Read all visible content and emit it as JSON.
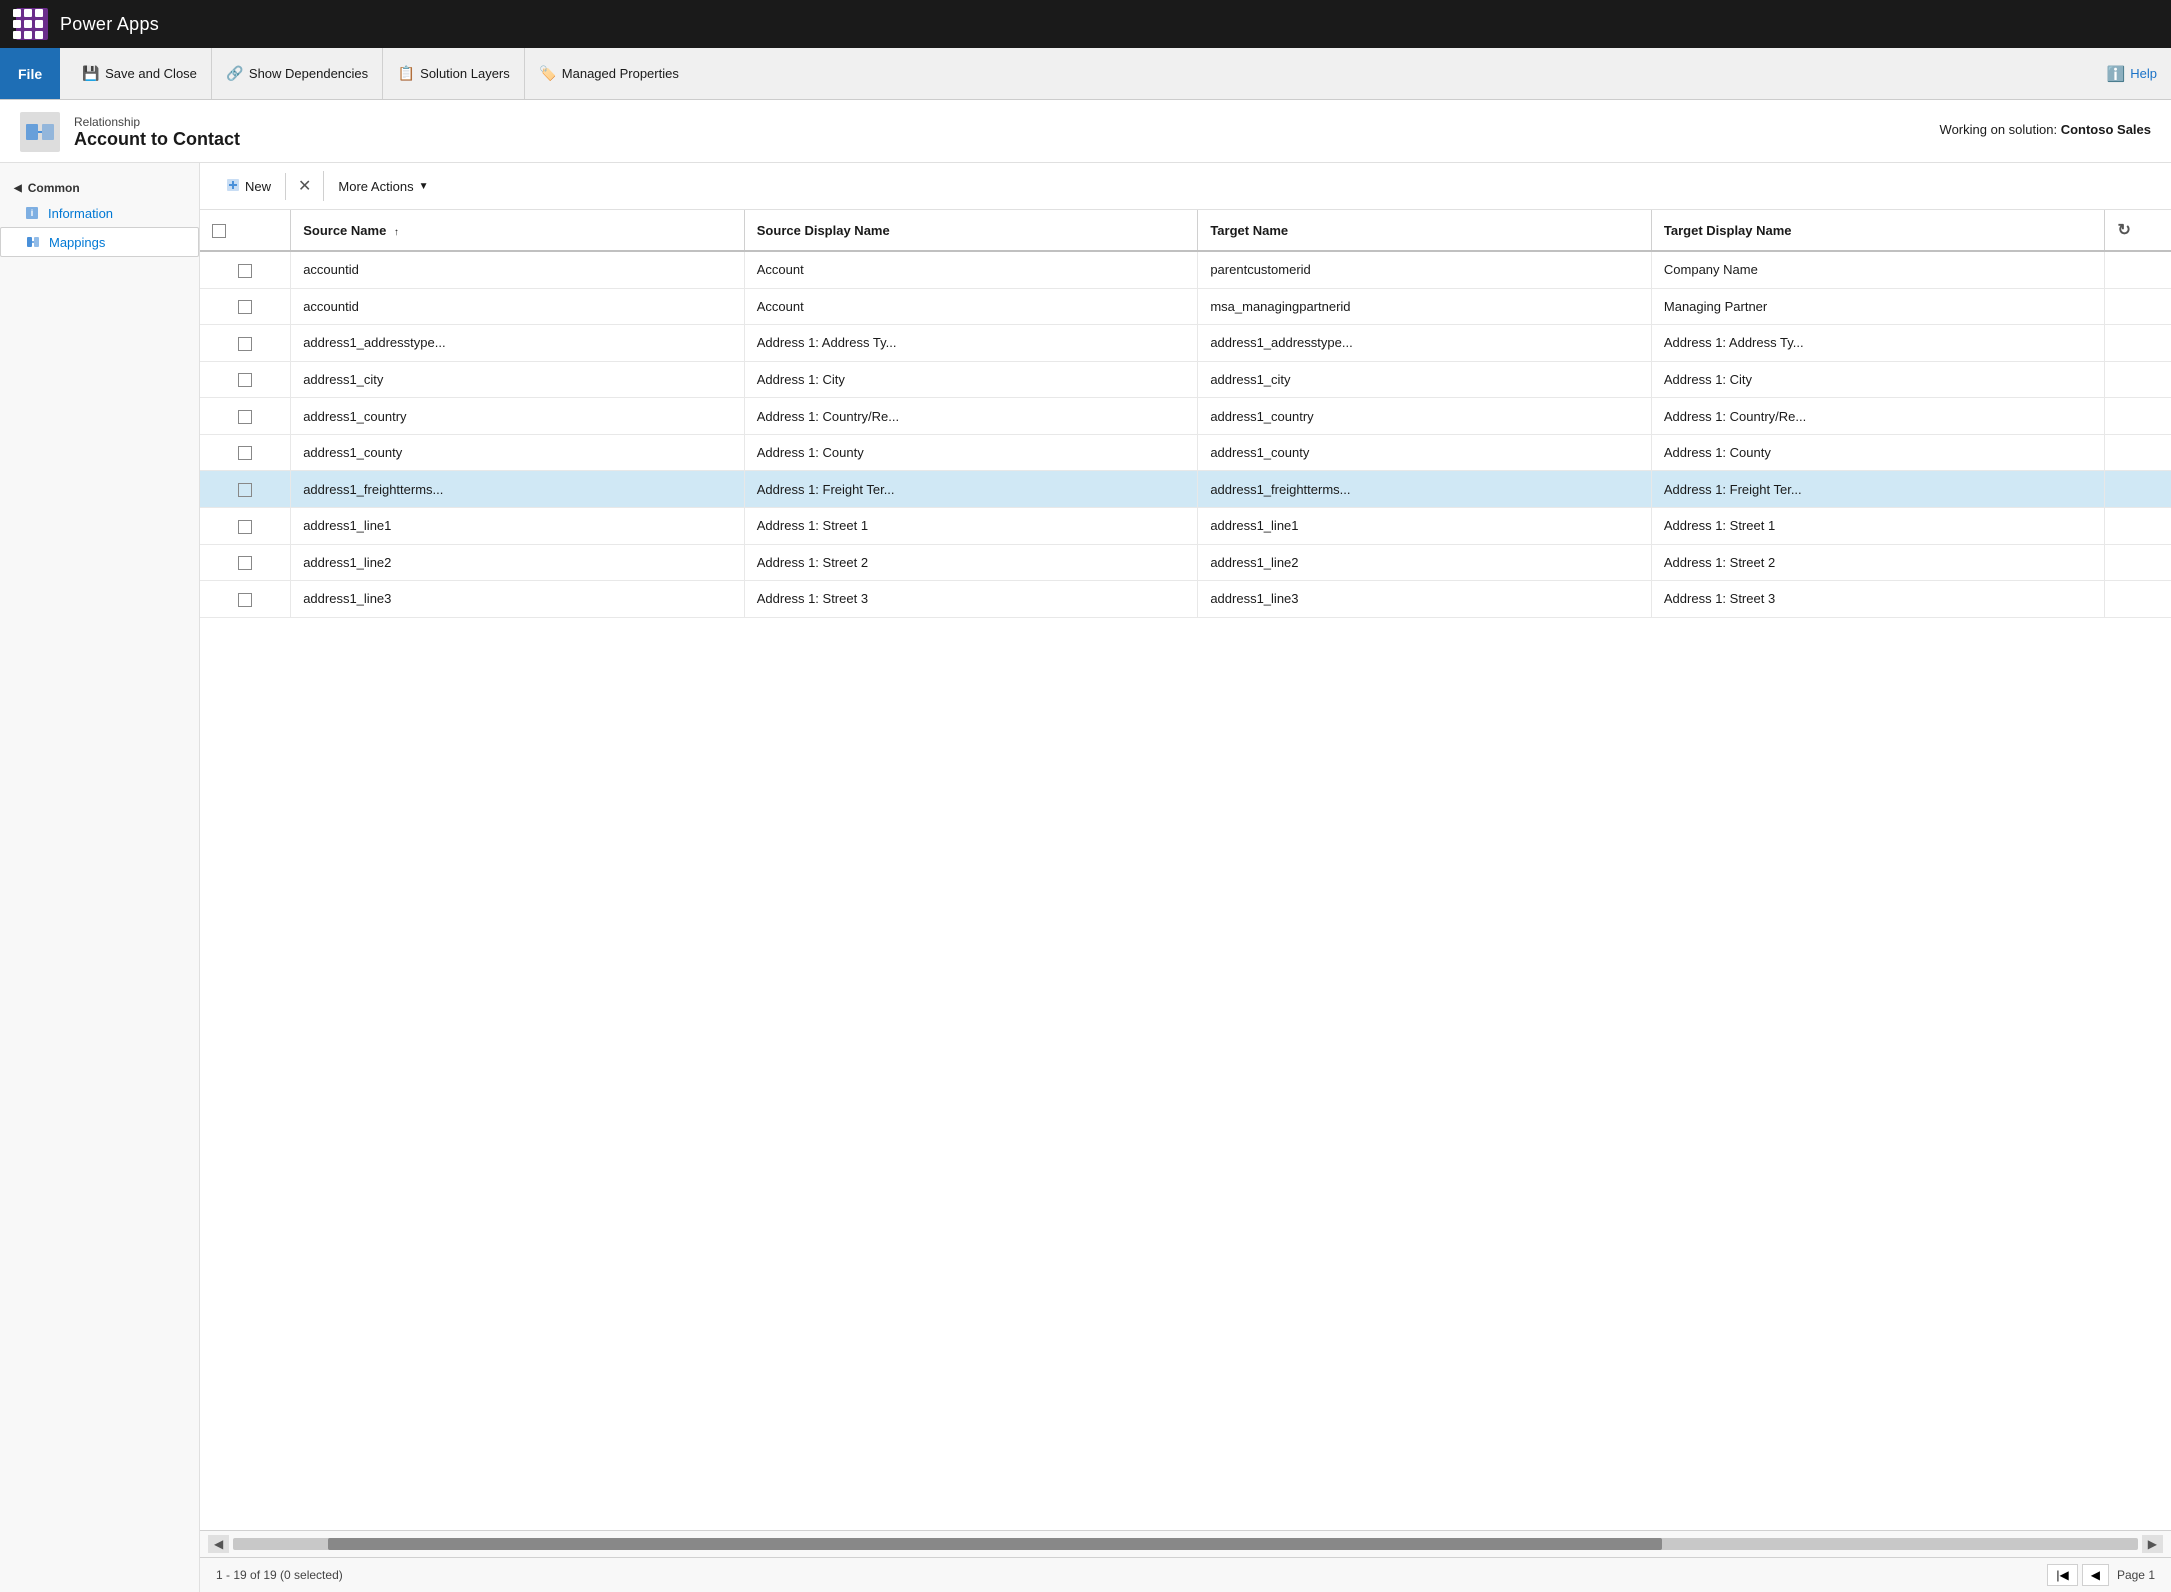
{
  "appBar": {
    "title": "Power Apps"
  },
  "ribbon": {
    "fileLabel": "File",
    "items": [
      {
        "id": "save-close",
        "label": "Save and Close",
        "icon": "💾"
      },
      {
        "id": "show-dependencies",
        "label": "Show Dependencies",
        "icon": "🔗"
      },
      {
        "id": "solution-layers",
        "label": "Solution Layers",
        "icon": "📋"
      },
      {
        "id": "managed-properties",
        "label": "Managed Properties",
        "icon": "🏷️"
      }
    ],
    "helpLabel": "Help"
  },
  "pageHeader": {
    "subtitle": "Relationship",
    "title": "Account to Contact",
    "workingOnLabel": "Working on solution:",
    "workingOnValue": "Contoso Sales"
  },
  "sidebar": {
    "sectionTitle": "Common",
    "items": [
      {
        "id": "information",
        "label": "Information",
        "active": false
      },
      {
        "id": "mappings",
        "label": "Mappings",
        "active": true
      }
    ]
  },
  "toolbar": {
    "newLabel": "New",
    "deleteIcon": "✕",
    "moreActionsLabel": "More Actions"
  },
  "grid": {
    "columns": [
      {
        "id": "select",
        "label": ""
      },
      {
        "id": "source-name",
        "label": "Source Name",
        "sortArrow": "↑"
      },
      {
        "id": "source-display-name",
        "label": "Source Display Name"
      },
      {
        "id": "target-name",
        "label": "Target Name"
      },
      {
        "id": "target-display-name",
        "label": "Target Display Name"
      },
      {
        "id": "refresh",
        "label": "↻"
      }
    ],
    "rows": [
      {
        "sourceName": "accountid",
        "sourceDisplayName": "Account",
        "targetName": "parentcustomerid",
        "targetDisplayName": "Company Name",
        "highlighted": false
      },
      {
        "sourceName": "accountid",
        "sourceDisplayName": "Account",
        "targetName": "msa_managingpartnerid",
        "targetDisplayName": "Managing Partner",
        "highlighted": false
      },
      {
        "sourceName": "address1_addresstype...",
        "sourceDisplayName": "Address 1: Address Ty...",
        "targetName": "address1_addresstype...",
        "targetDisplayName": "Address 1: Address Ty...",
        "highlighted": false
      },
      {
        "sourceName": "address1_city",
        "sourceDisplayName": "Address 1: City",
        "targetName": "address1_city",
        "targetDisplayName": "Address 1: City",
        "highlighted": false
      },
      {
        "sourceName": "address1_country",
        "sourceDisplayName": "Address 1: Country/Re...",
        "targetName": "address1_country",
        "targetDisplayName": "Address 1: Country/Re...",
        "highlighted": false
      },
      {
        "sourceName": "address1_county",
        "sourceDisplayName": "Address 1: County",
        "targetName": "address1_county",
        "targetDisplayName": "Address 1: County",
        "highlighted": false
      },
      {
        "sourceName": "address1_freightterms...",
        "sourceDisplayName": "Address 1: Freight Ter...",
        "targetName": "address1_freightterms...",
        "targetDisplayName": "Address 1: Freight Ter...",
        "highlighted": true
      },
      {
        "sourceName": "address1_line1",
        "sourceDisplayName": "Address 1: Street 1",
        "targetName": "address1_line1",
        "targetDisplayName": "Address 1: Street 1",
        "highlighted": false
      },
      {
        "sourceName": "address1_line2",
        "sourceDisplayName": "Address 1: Street 2",
        "targetName": "address1_line2",
        "targetDisplayName": "Address 1: Street 2",
        "highlighted": false
      },
      {
        "sourceName": "address1_line3",
        "sourceDisplayName": "Address 1: Street 3",
        "targetName": "address1_line3",
        "targetDisplayName": "Address 1: Street 3",
        "highlighted": false
      }
    ]
  },
  "footer": {
    "recordInfo": "1 - 19 of 19 (0 selected)",
    "pageLabel": "Page 1"
  }
}
